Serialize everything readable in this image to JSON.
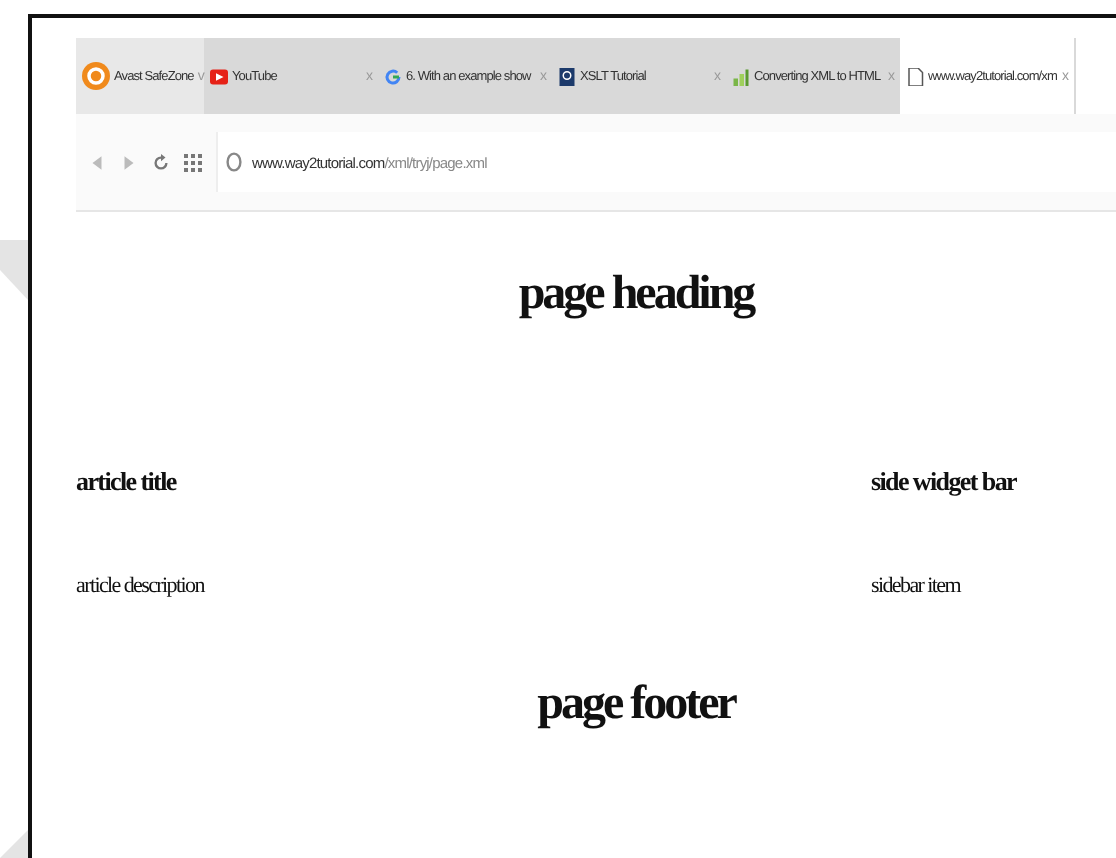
{
  "browser": {
    "tabs": [
      {
        "kind": "profile",
        "title": "Avast SafeZone",
        "close": "v",
        "selected": false
      },
      {
        "kind": "youtube",
        "title": "YouTube",
        "close": "x",
        "selected": false
      },
      {
        "kind": "google",
        "title": "6. With an example show",
        "close": "x",
        "selected": false
      },
      {
        "kind": "xslt",
        "title": "XSLT Tutorial",
        "close": "x",
        "selected": false
      },
      {
        "kind": "chart",
        "title": "Converting XML to HTML",
        "close": "x",
        "selected": false
      },
      {
        "kind": "page",
        "title": "www.way2tutorial.com/xm",
        "close": "x",
        "selected": true
      }
    ],
    "address": {
      "host": "www.way2tutorial.com",
      "path": "/xml/tryj/page.xml"
    }
  },
  "page": {
    "heading": "page heading",
    "article": {
      "title": "article title",
      "description": "article description"
    },
    "sidebar": {
      "title": "side widget bar",
      "item": "sidebar item"
    },
    "footer": "page footer"
  }
}
